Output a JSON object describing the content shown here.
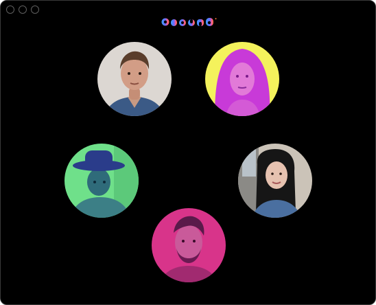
{
  "app": {
    "logo_text": "around",
    "brand_colors": [
      "#3aa0ff",
      "#6b6bff",
      "#ff5a8a",
      "#ff7a3a"
    ]
  },
  "window_controls": [
    "close",
    "minimize",
    "zoom"
  ],
  "participants": [
    {
      "id": "p1",
      "tint": "natural",
      "bg": "#d9d4cf"
    },
    {
      "id": "p2",
      "tint": "magenta-yellow",
      "bg": "#f6f05a"
    },
    {
      "id": "p3",
      "tint": "green-blue",
      "bg": "#6fe08a"
    },
    {
      "id": "p4",
      "tint": "natural",
      "bg": "#cfc8c0"
    },
    {
      "id": "p5",
      "tint": "magenta",
      "bg": "#d8348a"
    }
  ]
}
